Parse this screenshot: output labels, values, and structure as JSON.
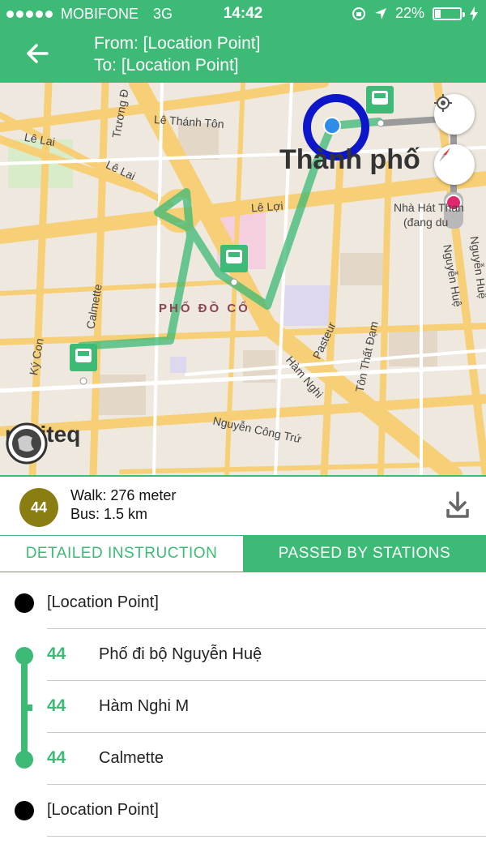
{
  "status_bar": {
    "carrier": "MOBIFONE",
    "network": "3G",
    "time": "14:42",
    "battery": "22%",
    "battery_level": 0.22
  },
  "header": {
    "from": "From: [Location Point]",
    "to": "To: [Location Point]"
  },
  "map": {
    "labels": {
      "le_thanh_ton": "Lê Thánh Tôn",
      "le_lai_1": "Lê Lai",
      "le_lai_2": "Lê Lai",
      "truong_dinh": "Trương Đ",
      "le_loi": "Lê Lợi",
      "thanh_pho": "Thành phố",
      "nha_hat_1": "Nhà Hát Than",
      "nha_hat_2": "(đang du",
      "pho_do_co": "PHỐ ĐỒ CỔ",
      "calmette": "Calmette",
      "ky_con": "Ký Con",
      "ham_nghi": "Hàm Nghi",
      "pasteur": "Pasteur",
      "ton_that_dam": "Tôn Thất Đạm",
      "nguyen_hue": "Nguyễn Huệ",
      "nguyen_cong_tru": "Nguyễn Công Trứ",
      "nguyen_hue_2": "Nguyễn Huệ"
    },
    "attribution": "nutiteq",
    "colors": {
      "route": "#3cba76",
      "roads": "#f7cf76",
      "location_ring": "#0d16c8"
    }
  },
  "summary": {
    "route_number": "44",
    "walk": "Walk: 276 meter",
    "bus": "Bus: 1.5 km"
  },
  "tabs": {
    "detailed": "DETAILED INSTRUCTION",
    "passed": "PASSED BY STATIONS",
    "active": "passed"
  },
  "stations": {
    "start": "[Location Point]",
    "end": "[Location Point]",
    "stops": [
      {
        "route": "44",
        "name": "Phố đi bộ Nguyễn Huệ"
      },
      {
        "route": "44",
        "name": "Hàm Nghi M"
      },
      {
        "route": "44",
        "name": "Calmette"
      }
    ]
  }
}
